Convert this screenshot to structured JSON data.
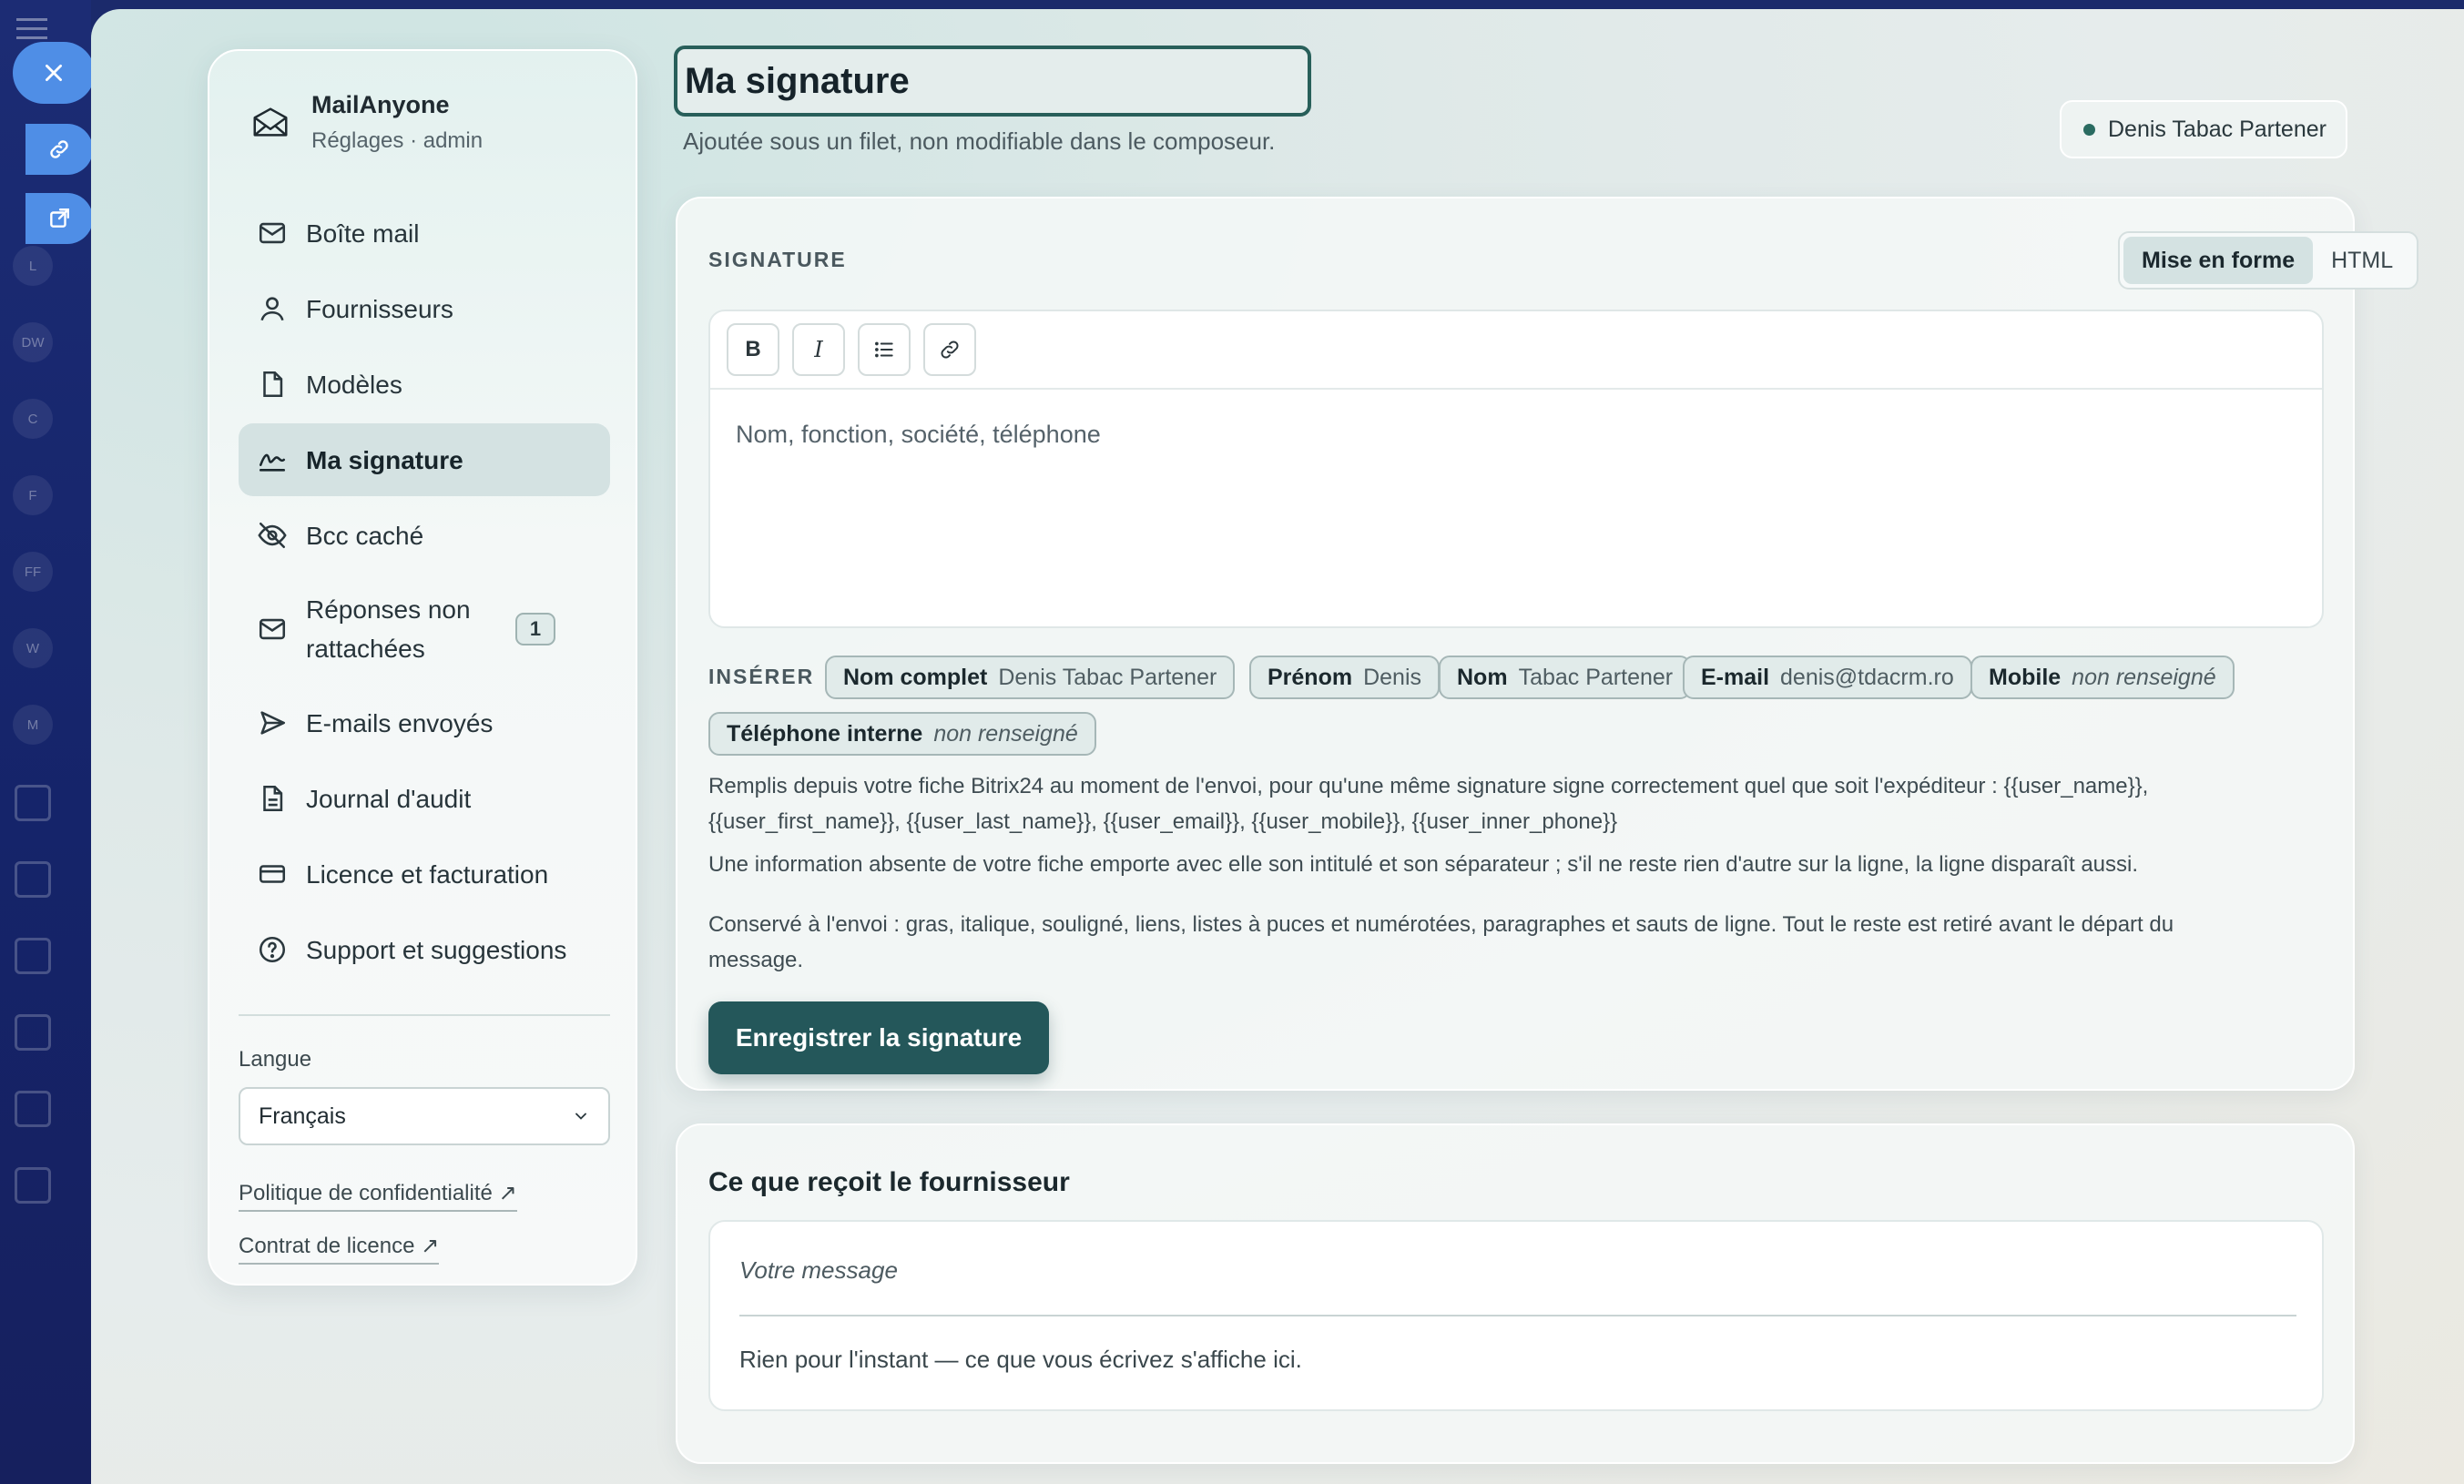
{
  "app": {
    "name": "MailAnyone",
    "subtitle": "Réglages · admin"
  },
  "sidebar": {
    "items": [
      {
        "label": "Boîte mail",
        "icon": "mail-icon"
      },
      {
        "label": "Fournisseurs",
        "icon": "user-icon"
      },
      {
        "label": "Modèles",
        "icon": "file-icon"
      },
      {
        "label": "Ma signature",
        "icon": "signature-icon",
        "active": true
      },
      {
        "label": "Bcc caché",
        "icon": "eye-off-icon"
      },
      {
        "label": "Réponses non rattachées",
        "icon": "mail-icon",
        "badge": "1"
      },
      {
        "label": "E-mails envoyés",
        "icon": "send-icon"
      },
      {
        "label": "Journal d'audit",
        "icon": "document-icon"
      },
      {
        "label": "Licence et facturation",
        "icon": "credit-card-icon"
      },
      {
        "label": "Support et suggestions",
        "icon": "help-circle-icon"
      }
    ],
    "language_label": "Langue",
    "language_value": "Français",
    "privacy_link": "Politique de confidentialité ↗",
    "license_link": "Contrat de licence ↗"
  },
  "header": {
    "title": "Ma signature",
    "subtitle": "Ajoutée sous un filet, non modifiable dans le composeur.",
    "user_name": "Denis Tabac Partener"
  },
  "signature": {
    "section_label": "SIGNATURE",
    "mode_rich": "Mise en forme",
    "mode_html": "HTML",
    "toolbar": {
      "bold": "B",
      "italic": "I"
    },
    "placeholder": "Nom, fonction, société, téléphone",
    "insert_label": "INSÉRER",
    "chips": [
      {
        "key": "Nom complet",
        "value": "Denis Tabac Partener"
      },
      {
        "key": "Prénom",
        "value": "Denis"
      },
      {
        "key": "Nom",
        "value": "Tabac Partener"
      },
      {
        "key": "E-mail",
        "value": "denis@tdacrm.ro"
      },
      {
        "key": "Mobile",
        "value": "non renseigné"
      },
      {
        "key": "Téléphone interne",
        "value": "non renseigné"
      }
    ],
    "help_1_line1": "Remplis depuis votre fiche Bitrix24 au moment de l'envoi, pour qu'une même signature signe correctement quel que soit l'expéditeur : {{user_name}},",
    "help_1_line2": "{{user_first_name}}, {{user_last_name}}, {{user_email}}, {{user_mobile}}, {{user_inner_phone}}",
    "help_2": "Une information absente de votre fiche emporte avec elle son intitulé et son séparateur ; s'il ne reste rien d'autre sur la ligne, la ligne disparaît aussi.",
    "help_3_line1": "Conservé à l'envoi : gras, italique, souligné, liens, listes à puces et numérotées, paragraphes et sauts de ligne. Tout le reste est retiré avant le départ du",
    "help_3_line2": "message.",
    "save_label": "Enregistrer la signature"
  },
  "preview": {
    "title": "Ce que reçoit le fournisseur",
    "message": "Votre message",
    "empty": "Rien pour l'instant — ce que vous écrivez s'affiche ici."
  },
  "background_rail": {
    "avatars": [
      "L",
      "DW",
      "C",
      "F",
      "FF",
      "W",
      "M"
    ]
  },
  "colors": {
    "accent": "#24575a",
    "rail": "#1c2c74",
    "slider_button": "#4f8ee6",
    "status_dot": "#2a6b61"
  }
}
